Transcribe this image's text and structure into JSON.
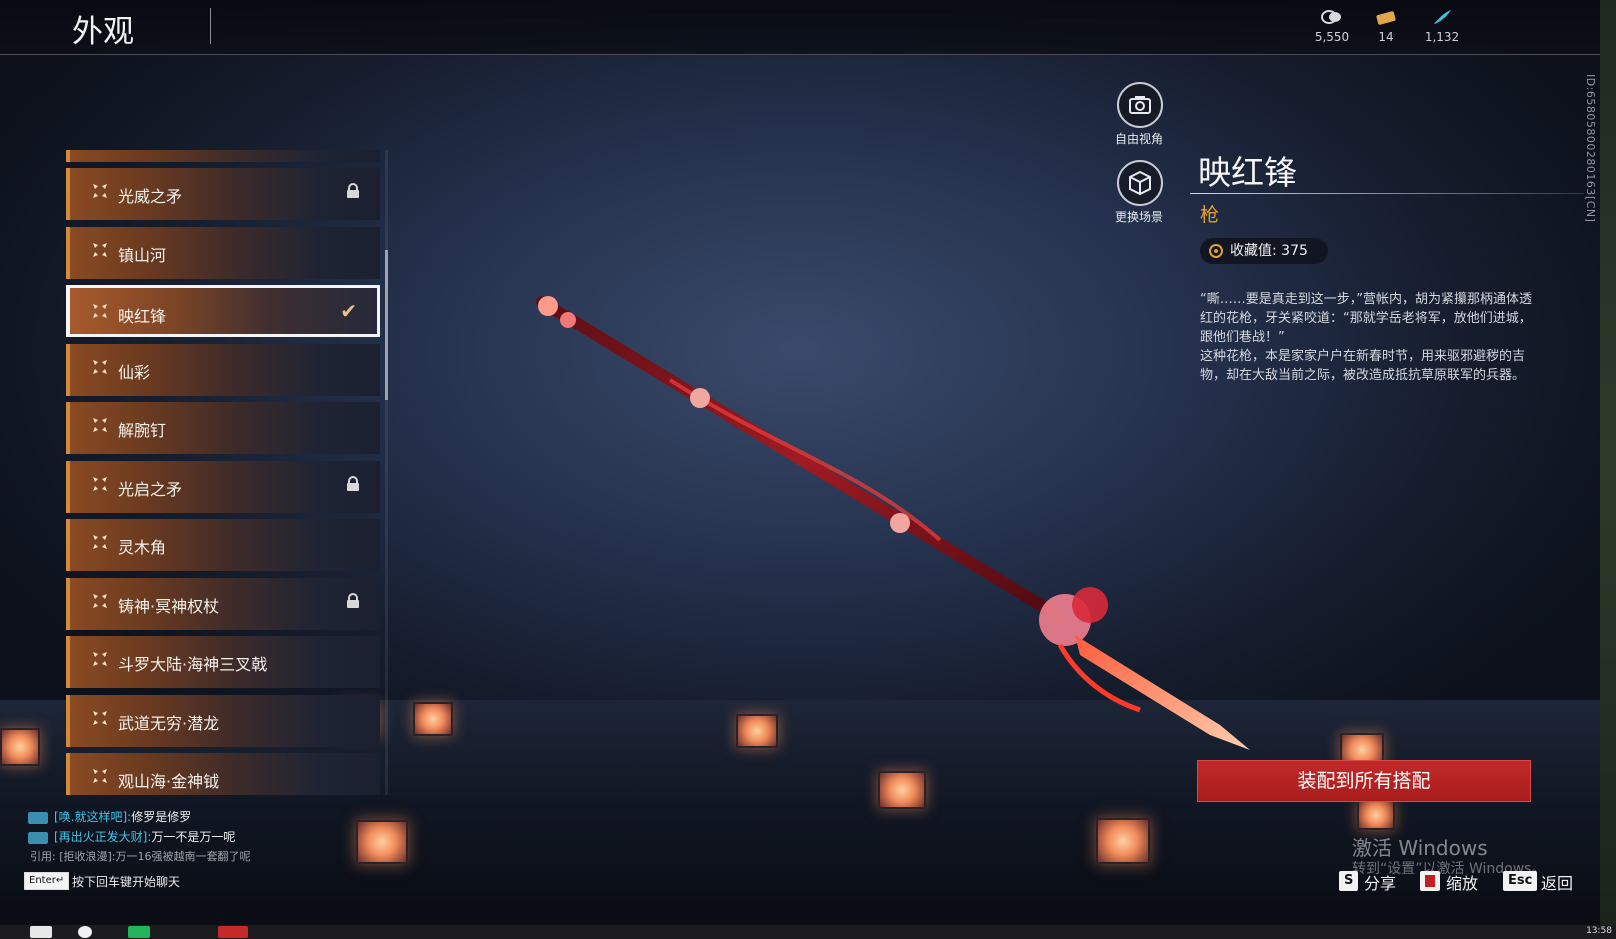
{
  "header": {
    "title": "外观",
    "currencies": [
      {
        "icon": "coin-icon",
        "value": "5,550"
      },
      {
        "icon": "ticket-icon",
        "value": "14"
      },
      {
        "icon": "feather-icon",
        "value": "1,132"
      }
    ]
  },
  "side_id": "ID:658058002801​63[CN]",
  "list": {
    "items": [
      {
        "label": "光威之矛",
        "locked": true,
        "selected": false
      },
      {
        "label": "镇山河",
        "locked": false,
        "selected": false
      },
      {
        "label": "映红锋",
        "locked": false,
        "selected": true
      },
      {
        "label": "仙彩",
        "locked": false,
        "selected": false
      },
      {
        "label": "解腕钉",
        "locked": false,
        "selected": false
      },
      {
        "label": "光启之矛",
        "locked": true,
        "selected": false
      },
      {
        "label": "灵木角",
        "locked": false,
        "selected": false
      },
      {
        "label": "铸神·冥神权杖",
        "locked": true,
        "selected": false
      },
      {
        "label": "斗罗大陆·海神三叉戟",
        "locked": false,
        "selected": false
      },
      {
        "label": "武道无穷·潜龙",
        "locked": false,
        "selected": false
      },
      {
        "label": "观山海·金神钺",
        "locked": false,
        "selected": false
      }
    ]
  },
  "view_buttons": {
    "free_view": "自由视角",
    "change_scene": "更换场景"
  },
  "detail": {
    "name": "映红锋",
    "type": "枪",
    "collect_label": "收藏值: 375",
    "description": "“嘶……要是真走到这一步，”营帐内，胡为紧攥那柄通体透红的花枪，牙关紧咬道：“那就学岳老将军，放他们进城，跟他们巷战！”\n这种花枪，本是家家户户在新春时节，用来驱邪避秽的吉物，却在大敌当前之际，被改造成抵抗草原联军的兵器。",
    "equip_all": "装配到所有搭配"
  },
  "windows_activation": {
    "title": "激活 Windows",
    "subtitle": "转到“设置”以激活 Windows。"
  },
  "hints": [
    {
      "key": "S",
      "label": "分享"
    },
    {
      "key": "",
      "label": "缩放"
    },
    {
      "key": "Esc",
      "label": "返回"
    }
  ],
  "chat": {
    "lines": [
      {
        "name": "[唤.就这样吧]:",
        "text": "修罗是修罗"
      },
      {
        "name": "[再出火正发大财]:",
        "text": "万一不是万一呢"
      }
    ],
    "quote": "引用: [拒收浪漫]:万一16强被越南一套翻了呢",
    "enter_key": "Enter↵",
    "enter_hint": "按下回车键开始聊天"
  },
  "clock": "13:58",
  "colors": {
    "accent_orange": "#d38a3a",
    "type_gold": "#e4a12e",
    "equip_red": "#b82222",
    "chat_cyan": "#3fc3e6"
  }
}
